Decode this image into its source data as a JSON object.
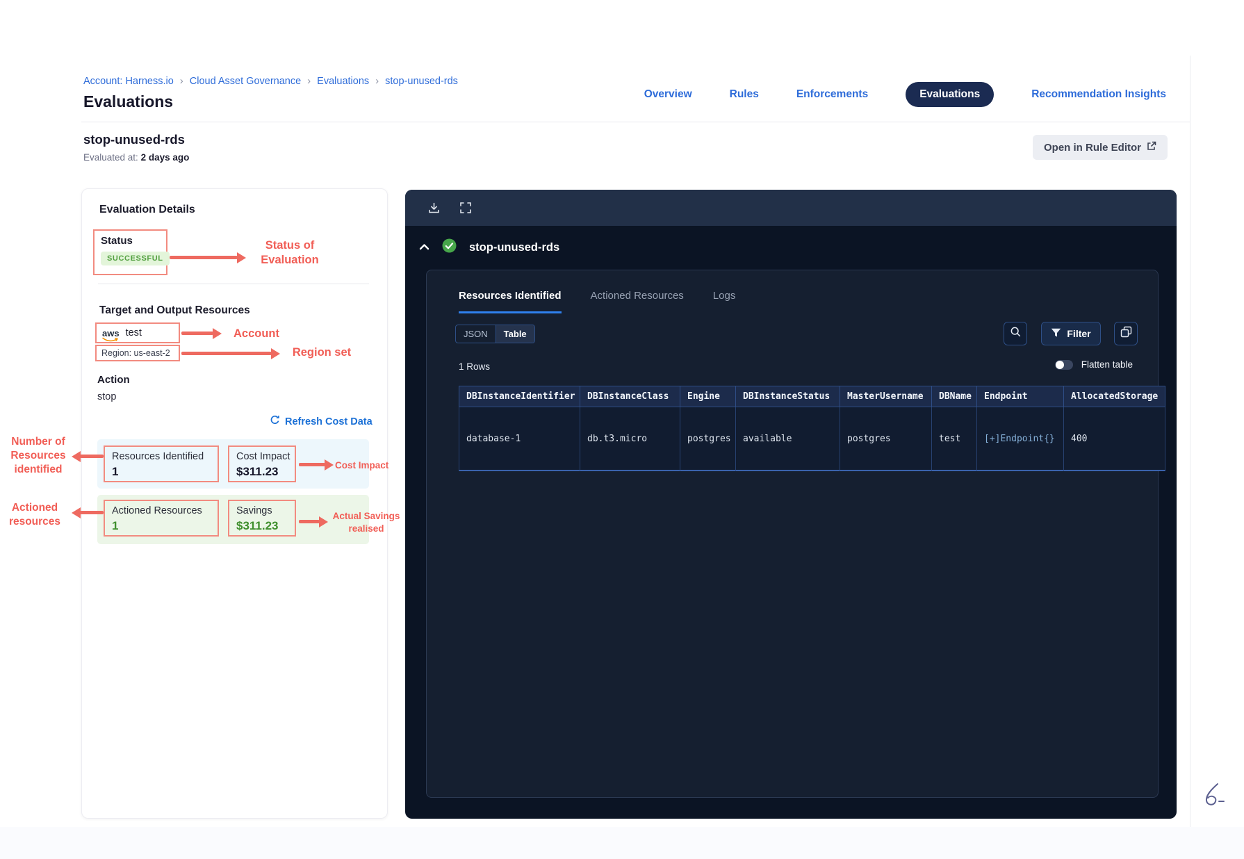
{
  "colors": {
    "accent_blue": "#2e6cd9",
    "annotation_red": "#f15e56",
    "success_green": "#55a143",
    "savings_green": "#3f8f2d",
    "panel_bg": "#0b1424",
    "pill_navy": "#1b2b52"
  },
  "breadcrumb": {
    "separator": "›",
    "items": [
      "Account: Harness.io",
      "Cloud Asset Governance",
      "Evaluations",
      "stop-unused-rds"
    ]
  },
  "page": {
    "title": "Evaluations"
  },
  "nav": {
    "items": [
      {
        "label": "Overview"
      },
      {
        "label": "Rules"
      },
      {
        "label": "Enforcements"
      },
      {
        "label": "Evaluations",
        "active": true
      },
      {
        "label": "Recommendation Insights"
      }
    ]
  },
  "subheader": {
    "title": "stop-unused-rds",
    "evaluated_label": "Evaluated at:",
    "evaluated_value": "2 days ago",
    "open_button": "Open in Rule Editor"
  },
  "details": {
    "heading": "Evaluation Details",
    "status_label": "Status",
    "status_value": "SUCCESSFUL",
    "target_heading": "Target and Output Resources",
    "aws_label": "aws",
    "account_name": "test",
    "region": "Region: us-east-2",
    "action_label": "Action",
    "action_value": "stop",
    "refresh_link": "Refresh Cost Data",
    "metrics": {
      "resources_identified_label": "Resources Identified",
      "resources_identified_value": "1",
      "cost_impact_label": "Cost Impact",
      "cost_impact_value": "$311.23",
      "actioned_label": "Actioned Resources",
      "actioned_value": "1",
      "savings_label": "Savings",
      "savings_value": "$311.23"
    }
  },
  "annotations": {
    "status": "Status of Evaluation",
    "account": "Account",
    "region": "Region set",
    "resources": "Number of Resources identified",
    "cost": "Cost Impact",
    "actioned": "Actioned resources",
    "savings": "Actual Savings realised"
  },
  "panel": {
    "title": "stop-unused-rds",
    "tabs": [
      {
        "label": "Resources Identified",
        "active": true
      },
      {
        "label": "Actioned Resources"
      },
      {
        "label": "Logs"
      }
    ],
    "view_toggle": {
      "options": [
        "JSON",
        "Table"
      ],
      "selected": "Table"
    },
    "filter_button": "Filter",
    "rows_count": "1 Rows",
    "flatten_label": "Flatten table",
    "table": {
      "columns": [
        "DBInstanceIdentifier",
        "DBInstanceClass",
        "Engine",
        "DBInstanceStatus",
        "MasterUsername",
        "DBName",
        "Endpoint",
        "AllocatedStorage"
      ],
      "rows": [
        [
          "database-1",
          "db.t3.micro",
          "postgres",
          "available",
          "postgres",
          "test",
          "[+]Endpoint{}",
          "400"
        ]
      ]
    }
  }
}
